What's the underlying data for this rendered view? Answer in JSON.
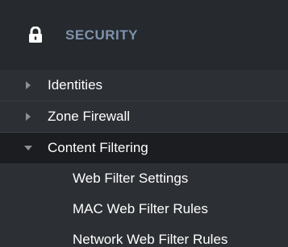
{
  "header": {
    "title": "SECURITY",
    "icon": "lock-icon"
  },
  "nav": {
    "items": [
      {
        "label": "Identities",
        "icon": "chevron-right-icon",
        "expanded": false
      },
      {
        "label": "Zone Firewall",
        "icon": "chevron-right-icon",
        "expanded": false
      },
      {
        "label": "Content Filtering",
        "icon": "chevron-down-icon",
        "expanded": true
      }
    ],
    "subitems": [
      {
        "label": "Web Filter Settings"
      },
      {
        "label": "MAC Web Filter Rules"
      },
      {
        "label": "Network Web Filter Rules"
      }
    ]
  },
  "colors": {
    "header_title": "#7d93ad",
    "background": "#2c2f33",
    "header_bg": "#26292d",
    "active_bg": "#1b1d20",
    "text": "#ffffff",
    "caret": "#8c9196"
  }
}
